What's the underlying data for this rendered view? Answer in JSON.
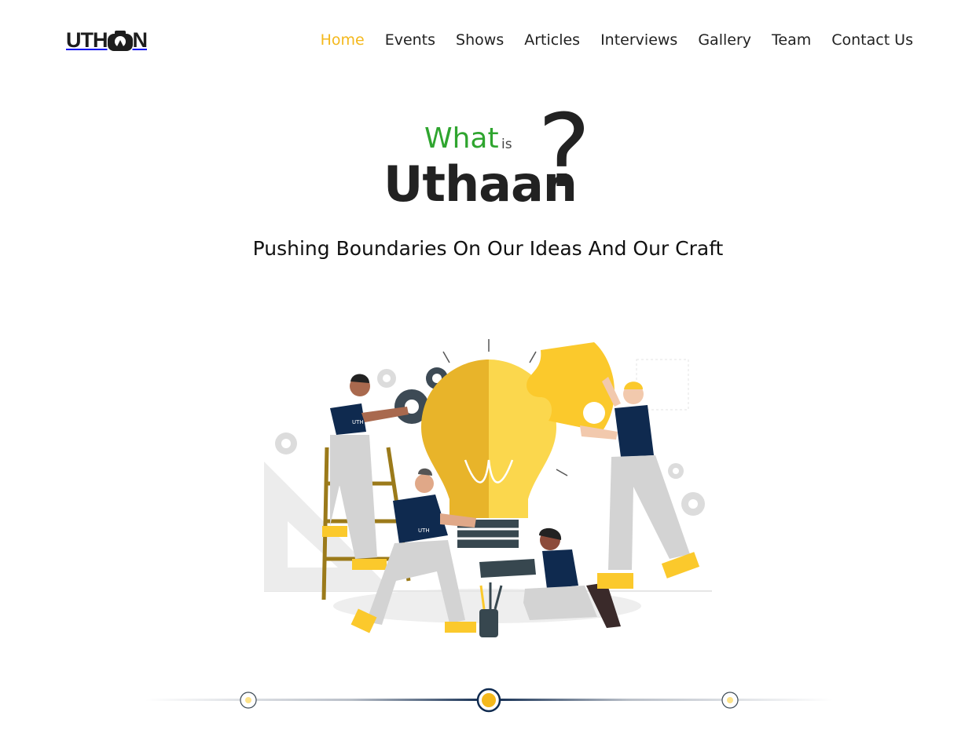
{
  "brand": {
    "logo_text_left": "UTH",
    "logo_text_right": "N"
  },
  "nav": {
    "items": [
      {
        "label": "Home",
        "active": true
      },
      {
        "label": "Events",
        "active": false
      },
      {
        "label": "Shows",
        "active": false
      },
      {
        "label": "Articles",
        "active": false
      },
      {
        "label": "Interviews",
        "active": false
      },
      {
        "label": "Gallery",
        "active": false
      },
      {
        "label": "Team",
        "active": false
      },
      {
        "label": "Contact Us",
        "active": false
      }
    ]
  },
  "hero": {
    "what": "What",
    "is": "is",
    "title": "Uthaan",
    "qmark": "?",
    "tagline": "Pushing Boundaries On Our Ideas And Our Craft"
  },
  "illustration": {
    "subject": "team assembling a lightbulb puzzle",
    "shirt_logo": "UTH"
  },
  "carousel": {
    "slides": 3,
    "active_index": 1
  },
  "colors": {
    "accent": "#f4b81c",
    "green": "#2fa52f",
    "navy": "#0f2a4f",
    "text": "#222222"
  }
}
